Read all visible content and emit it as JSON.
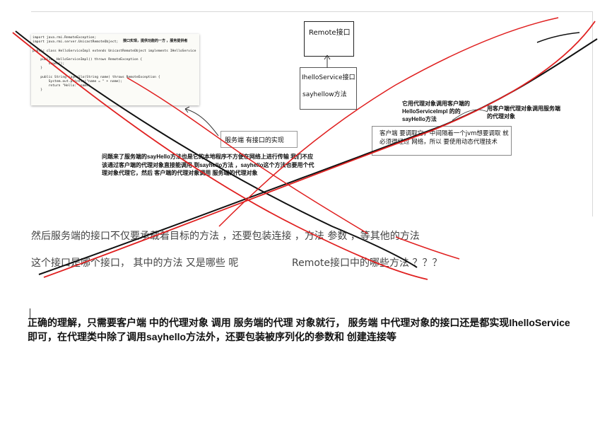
{
  "code_snippet": {
    "lines": [
      "import java.rmi.RemoteException;",
      "import java.rmi.server.UnicastRemoteObject;",
      "",
      "public class HelloServiceImpl extends UnicastRemoteObject implements IHelloService",
      "",
      "    public  HelloServiceImpl() throws RemoteException {",
      "        super();",
      "    }",
      "",
      "    public String sayHello(String name) throws RemoteException {",
      "        System.out.println(\"name = \" + name);",
      "        return \"Hello:\"+name;",
      "    }"
    ],
    "note": "接口实现，提供功能的一方 ，服务提供者"
  },
  "remote_box": {
    "label": "Remote接口"
  },
  "service_box": {
    "line1": "IhelloService接口",
    "line2": "sayhellow方法"
  },
  "server_callout": {
    "text": "服务端 有接口的实现"
  },
  "client_callout": {
    "text": "客户端 要调取它，中间隔着一个jvm想要调取 就必须得经过 网络，所以 要使用动态代理技术"
  },
  "note_proxy_call": "它用代理对象调用客户端的 HelloServiceImpl 的的sayHello方法",
  "note_client_proxy": "用客户端代理对象调用服务端的代理对象",
  "question_note": "问题来了服务端的sayHello方法也是它的本地程序不方便在网络上进行传输 我们不应该通过客户端的代理对象直接能调用 到sayhello方法 ，sayhello这个方法也要用个代理对象代理它，然后 客户端的代理对象调用 服务端的代理对象",
  "paragraph1": "然后服务端的接口不仅要承载着目标的方法 ，还要包装连接 ，方法 参数 ，等其他的方法",
  "paragraph2_a": "这个接口是哪个接口， 其中的方法 又是哪些 呢",
  "paragraph2_b": "Remote接口中的哪些方法 ？？？",
  "answer": "正确的理解，只需要客户端 中的代理对象 调用 服务端的代理 对象就行， 服务端 中代理对象的接口还是都实现IhelloService即可，在代理类中除了调用sayhello方法外，还要包装被序列化的参数和 创建连接等",
  "colors": {
    "strike_red": "#e02020",
    "strike_black": "#111111"
  }
}
